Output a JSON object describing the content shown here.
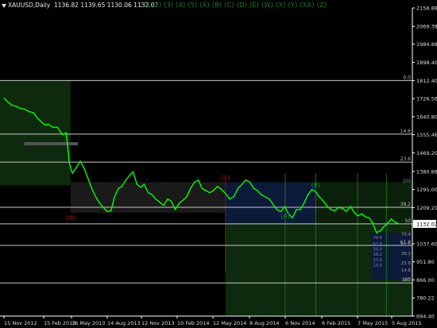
{
  "header": {
    "symbol": "XAUUSD,Daily",
    "ohlc": "1136.82 1139.65 1130.06 1132.02"
  },
  "wave_labels": [
    "(1)",
    "(2)",
    "(3)",
    "(4)",
    "(5)",
    "(A)",
    "(B)",
    "(C)",
    "(D)",
    "(E)",
    "(W)",
    "(X)",
    "(Y)",
    "(XX)",
    "(Z)"
  ],
  "colors": {
    "background": "#000000",
    "price_line": "#00ff00",
    "axis": "#ffffff",
    "fib_line": "#c8c8c8",
    "zone_green": "#0d2a0d",
    "zone_blue": "#0c1a3a",
    "zone_grey": "#1a1a1a",
    "wave_label": "#1c8a1c",
    "bear_label": "#a01010"
  },
  "chart_data": {
    "type": "line",
    "title": "XAUUSD,Daily",
    "y_ticks": [
      "2156.88",
      "2069.38",
      "1984.88",
      "1898.40",
      "1812.40",
      "1726.56",
      "1640.80",
      "1555.46",
      "1469.20",
      "1380.88",
      "1295.00",
      "1209.20",
      "1123.40",
      "1037.60",
      "951.80",
      "866.00",
      "780.22",
      "694.40"
    ],
    "current_price": "1132.02",
    "ylim": [
      694.4,
      2156.88
    ],
    "x_ticks": [
      "15 Nov 2012",
      "15 Feb 2013",
      "16 May 2013",
      "14 Aug 2013",
      "12 Nov 2013",
      "10 Feb 2014",
      "12 May 2014",
      "8 Aug 2014",
      "6 Nov 2014",
      "6 Feb 2015",
      "7 May 2015",
      "5 Aug 2015"
    ],
    "fib_levels": [
      {
        "label": "0.0",
        "price": 1812.4
      },
      {
        "label": "14.6",
        "price": 1558
      },
      {
        "label": "23.6",
        "price": 1425
      },
      {
        "label": "38.2",
        "price": 1211
      },
      {
        "label": "50",
        "price": 1132
      },
      {
        "label": "61.8",
        "price": 1030
      },
      {
        "label": "100",
        "price": 852
      }
    ],
    "right_zone_ticks": [
      "100",
      "76.4",
      "61.8",
      "38.2",
      "23.6",
      "14.6",
      "0.0"
    ],
    "mini_fib_ticks": [
      "76.4",
      "61.8",
      "50.0",
      "38.2",
      "23.6",
      "14.6"
    ],
    "wave_annotations": [
      {
        "label": "(X)",
        "x": "11 Jun 2014",
        "price": 1340,
        "color": "bear"
      },
      {
        "label": "(W)",
        "x": "13 May 2013",
        "price": 1150,
        "color": "bear"
      },
      {
        "label": "(A)",
        "x": "6 Nov 2014",
        "price": 1160,
        "color": "wave"
      },
      {
        "label": "(B)",
        "x": "22 Jan 2015",
        "price": 1306,
        "color": "wave"
      }
    ],
    "series": [
      {
        "x_start": "15 Nov 2012",
        "x_end": "24 Aug 2015",
        "values": [
          1730,
          1710,
          1695,
          1690,
          1680,
          1676,
          1665,
          1660,
          1635,
          1615,
          1600,
          1606,
          1595,
          1590,
          1592,
          1570,
          1555,
          1565,
          1420,
          1372,
          1400,
          1430,
          1395,
          1350,
          1300,
          1260,
          1230,
          1210,
          1190,
          1195,
          1260,
          1300,
          1310,
          1340,
          1360,
          1380,
          1320,
          1305,
          1320,
          1280,
          1270,
          1250,
          1235,
          1220,
          1250,
          1240,
          1200,
          1230,
          1245,
          1260,
          1300,
          1330,
          1340,
          1300,
          1290,
          1280,
          1290,
          1310,
          1295,
          1275,
          1250,
          1260,
          1300,
          1320,
          1340,
          1330,
          1300,
          1290,
          1270,
          1260,
          1250,
          1225,
          1200,
          1190,
          1215,
          1180,
          1160,
          1200,
          1200,
          1230,
          1270,
          1295,
          1285,
          1260,
          1240,
          1215,
          1200,
          1195,
          1210,
          1205,
          1190,
          1215,
          1185,
          1170,
          1180,
          1165,
          1160,
          1135,
          1090,
          1100,
          1120,
          1135,
          1155,
          1140,
          1132
        ]
      }
    ]
  }
}
